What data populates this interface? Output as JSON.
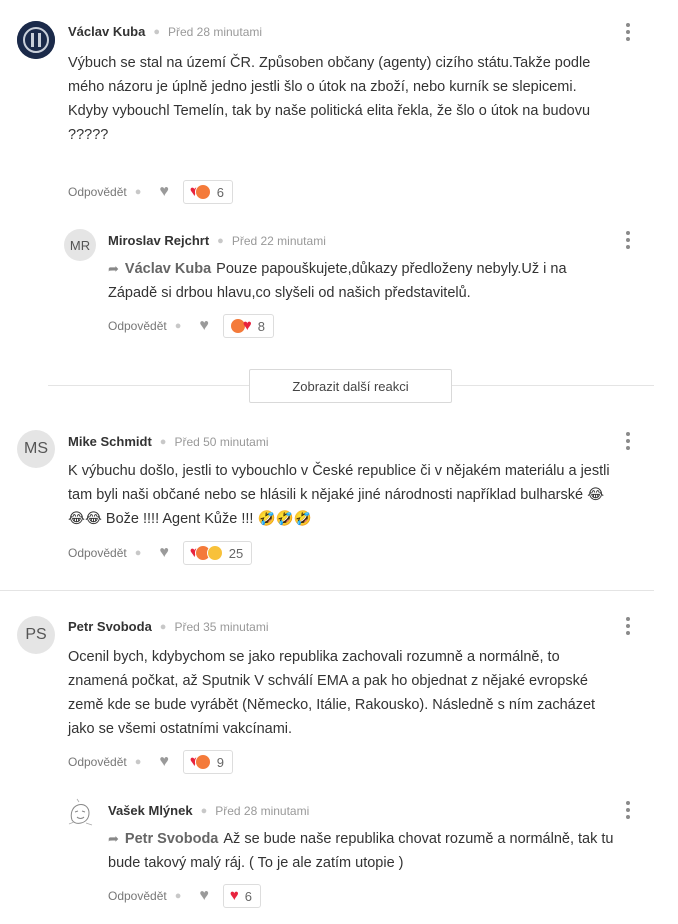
{
  "ui": {
    "reply_label": "Odpovědět",
    "show_more": "Zobrazit další reakci"
  },
  "comments": [
    {
      "author": "Václav Kuba",
      "time": "Před 28 minutami",
      "lines": [
        "Výbuch se stal na území ČR. Způsoben občany (agenty) cizího státu.Takže podle",
        "mého názoru je úplně jedno jestli šlo o útok na zboží, nebo kurník se slepicemi.",
        "Kdyby vybouchl Temelín, tak by naše politická elita řekla, že šlo o útok na budovu",
        "?????"
      ],
      "reaction_count": "6",
      "reactions": [
        "heart",
        "angry"
      ]
    },
    {
      "initials": "MR",
      "author": "Miroslav Rejchrt",
      "time": "Před 22 minutami",
      "reply_to": "Václav Kuba",
      "line1": "Pouze papouškujete,důkazy předloženy nebyly.Už i na",
      "line2": "Západě si drbou hlavu,co slyšeli od našich představitelů.",
      "reaction_count": "8",
      "reactions": [
        "angry",
        "heart"
      ]
    },
    {
      "initials": "MS",
      "author": "Mike Schmidt",
      "time": "Před 50 minutami",
      "lines": [
        "K výbuchu došlo, jestli to vybouchlo v České republice či v nějakém materiálu a jestli",
        "tam byli naši občané nebo se hlásili k nějaké jiné národnosti například bulharské 😂",
        "😂😂 Bože !!!! Agent Kůže !!! 🤣🤣🤣"
      ],
      "reaction_count": "25",
      "reactions": [
        "heart",
        "angry",
        "laugh"
      ]
    },
    {
      "initials": "PS",
      "author": "Petr Svoboda",
      "time": "Před 35 minutami",
      "lines": [
        "Ocenil bych, kdybychom se jako republika zachovali rozumně a normálně, to",
        "znamená počkat, až Sputnik V schválí EMA a pak ho objednat z nějaké evropské",
        "země kde se bude vyrábět (Německo, Itálie, Rakousko). Následně s ním zacházet",
        "jako se všemi ostatními vakcínami."
      ],
      "reaction_count": "9",
      "reactions": [
        "heart",
        "angry"
      ]
    },
    {
      "author": "Vašek Mlýnek",
      "time": "Před 28 minutami",
      "reply_to": "Petr Svoboda",
      "line1": "Až se bude naše republika chovat rozumě a normálně, tak tu",
      "line2": "bude takový malý ráj. ( To je ale zatím utopie )",
      "reaction_count": "6",
      "reactions": [
        "heart"
      ]
    }
  ],
  "colors": {
    "heart": "#e8233e",
    "angry": "#f47a3a",
    "laugh": "#f8c13a"
  }
}
